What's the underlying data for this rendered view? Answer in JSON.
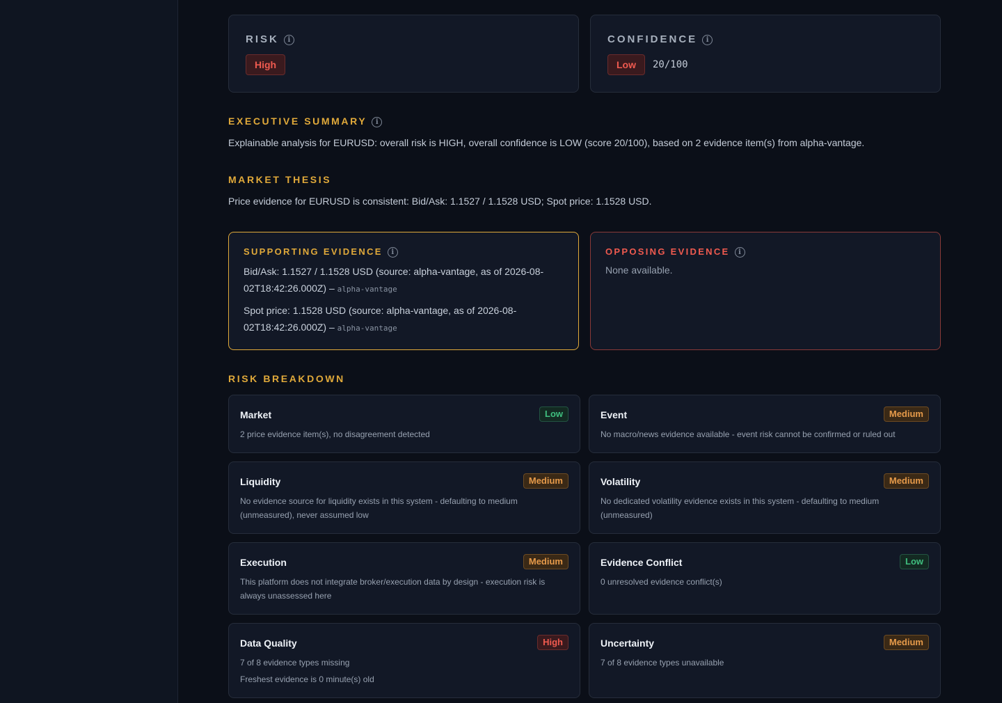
{
  "risk": {
    "label": "RISK",
    "level": "High"
  },
  "confidence": {
    "label": "CONFIDENCE",
    "level": "Low",
    "score": "20/100"
  },
  "executive_summary": {
    "title": "EXECUTIVE SUMMARY",
    "text": "Explainable analysis for EURUSD: overall risk is HIGH, overall confidence is LOW (score 20/100), based on 2 evidence item(s) from alpha-vantage."
  },
  "market_thesis": {
    "title": "MARKET THESIS",
    "text": "Price evidence for EURUSD is consistent: Bid/Ask: 1.1527 / 1.1528 USD; Spot price: 1.1528 USD."
  },
  "supporting_evidence": {
    "title": "SUPPORTING EVIDENCE",
    "items": [
      {
        "text": "Bid/Ask: 1.1527 / 1.1528 USD (source: alpha-vantage, as of 2026-08-02T18:42:26.000Z) –",
        "source": "alpha-vantage"
      },
      {
        "text": "Spot price: 1.1528 USD (source: alpha-vantage, as of 2026-08-02T18:42:26.000Z) –",
        "source": "alpha-vantage"
      }
    ]
  },
  "opposing_evidence": {
    "title": "OPPOSING EVIDENCE",
    "empty_text": "None available."
  },
  "risk_breakdown": {
    "title": "RISK BREAKDOWN",
    "items": [
      {
        "name": "Market",
        "level": "Low",
        "desc": "2 price evidence item(s), no disagreement detected",
        "desc2": ""
      },
      {
        "name": "Event",
        "level": "Medium",
        "desc": "No macro/news evidence available - event risk cannot be confirmed or ruled out",
        "desc2": ""
      },
      {
        "name": "Liquidity",
        "level": "Medium",
        "desc": "No evidence source for liquidity exists in this system - defaulting to medium (unmeasured), never assumed low",
        "desc2": ""
      },
      {
        "name": "Volatility",
        "level": "Medium",
        "desc": "No dedicated volatility evidence exists in this system - defaulting to medium (unmeasured)",
        "desc2": ""
      },
      {
        "name": "Execution",
        "level": "Medium",
        "desc": "This platform does not integrate broker/execution data by design - execution risk is always unassessed here",
        "desc2": ""
      },
      {
        "name": "Evidence Conflict",
        "level": "Low",
        "desc": "0 unresolved evidence conflict(s)",
        "desc2": ""
      },
      {
        "name": "Data Quality",
        "level": "High",
        "desc": "7 of 8 evidence types missing",
        "desc2": "Freshest evidence is 0 minute(s) old"
      },
      {
        "name": "Uncertainty",
        "level": "Medium",
        "desc": "7 of 8 evidence types unavailable",
        "desc2": ""
      }
    ]
  },
  "colors": {
    "accent": "#e0a93a",
    "high": "#ef5a4f",
    "medium": "#e69a4a",
    "low": "#3fbf7f"
  }
}
